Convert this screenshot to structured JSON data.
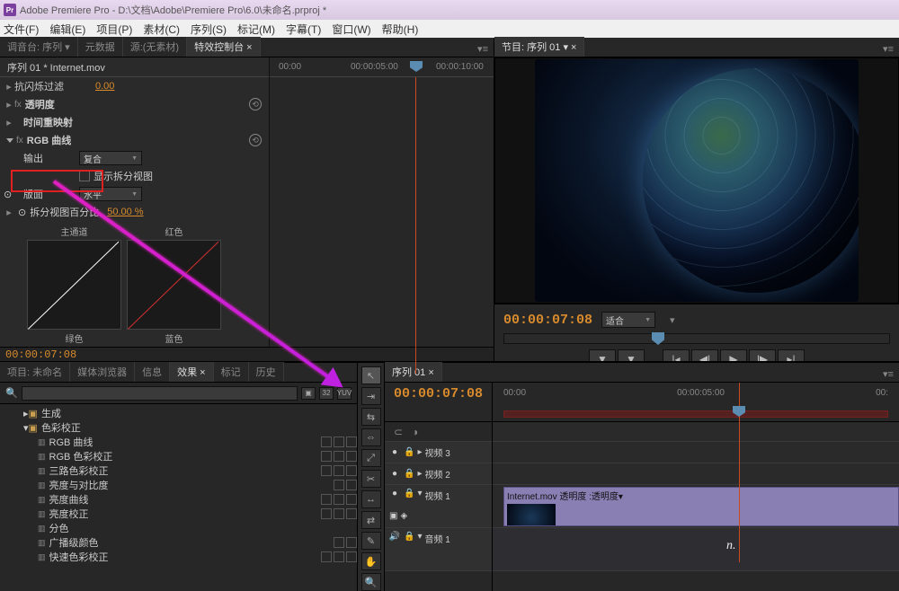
{
  "titlebar": "Adobe Premiere Pro - D:\\文档\\Adobe\\Premiere Pro\\6.0\\未命名.prproj *",
  "proj_badge": "Pr",
  "menu": [
    "文件(F)",
    "编辑(E)",
    "项目(P)",
    "素材(C)",
    "序列(S)",
    "标记(M)",
    "字幕(T)",
    "窗口(W)",
    "帮助(H)"
  ],
  "ec_tabs": {
    "audio": "调音台: 序列",
    "meta": "元数据",
    "source": "源:(无素材)",
    "fx": "特效控制台"
  },
  "ec_head": "序列  01 * Internet.mov",
  "ec_rows": {
    "antiflick": "抗闪烁过滤",
    "antiflick_val": "0.00",
    "opacity": "透明度",
    "timeremap": "时间重映射",
    "rgbcurve": "RGB 曲线",
    "output": "输出",
    "output_val": "复合",
    "showsplit": "显示拆分视图",
    "layout": "版面",
    "layout_val": "水平",
    "splitpct": "拆分视图百分比",
    "splitpct_val": "50.00 %"
  },
  "curve_labels": {
    "master": "主通道",
    "red": "红色",
    "green": "绿色",
    "blue": "蓝色"
  },
  "ec_ruler": {
    "t0": "00:00",
    "t1": "00:00:05:00",
    "t2": "00:00:10:00"
  },
  "ec_bottom_tc": "00:00:07:08",
  "program": {
    "tab": "节目: 序列 01",
    "tc": "00:00:07:08",
    "zoom": "适合"
  },
  "proj_tabs": {
    "proj": "项目: 未命名",
    "media": "媒体浏览器",
    "info": "信息",
    "fx": "效果",
    "mark": "标记",
    "hist": "历史"
  },
  "effects": {
    "gen": "生成",
    "colorcorr": "色彩校正",
    "items": [
      "RGB 曲线",
      "RGB 色彩校正",
      "三路色彩校正",
      "亮度与对比度",
      "亮度曲线",
      "亮度校正",
      "分色",
      "广播级颜色",
      "快速色彩校正"
    ]
  },
  "timeline": {
    "tab": "序列 01",
    "tc": "00:00:07:08",
    "ruler": [
      "00:00",
      "00:00:05:00",
      "00:"
    ],
    "tracks": {
      "v3": "视频 3",
      "v2": "视频 2",
      "v1": "视频 1",
      "a1": "音频 1"
    },
    "clip": "Internet.mov  透明度 :透明度▾",
    "n": "n."
  },
  "icon32": "32",
  "iconYuv": "YUV"
}
